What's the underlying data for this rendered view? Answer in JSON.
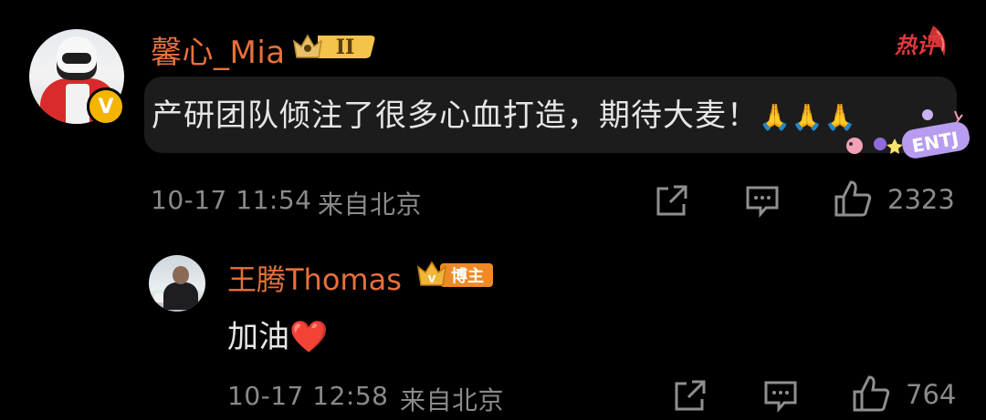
{
  "main_comment": {
    "username": "馨心_Mia",
    "level": "II",
    "hot_label": "热评",
    "text": "产研团队倾注了很多心血打造，期待大麦！",
    "emoji": "🙏🙏🙏",
    "sticker_text": "ENTJ",
    "timestamp": "10-17 11:54",
    "location": "来自北京",
    "like_count": "2323"
  },
  "reply": {
    "username": "王腾Thomas",
    "badge_label": "博主",
    "text": "加油",
    "heart": "❤️",
    "timestamp": "10-17 12:58",
    "location": "来自北京",
    "like_count": "764"
  },
  "colors": {
    "background": "#000000",
    "username": "#e8703a",
    "text": "#e6e6e6",
    "meta": "#8a8a8a",
    "badge_gold": "#f0b63a",
    "badge_orange": "#f08a24",
    "hot_red": "#e0383c"
  },
  "icons": {
    "share": "share-icon",
    "comment": "comment-icon",
    "like": "thumbs-up-icon",
    "verified": "verified-v-icon",
    "crown": "crown-icon"
  }
}
